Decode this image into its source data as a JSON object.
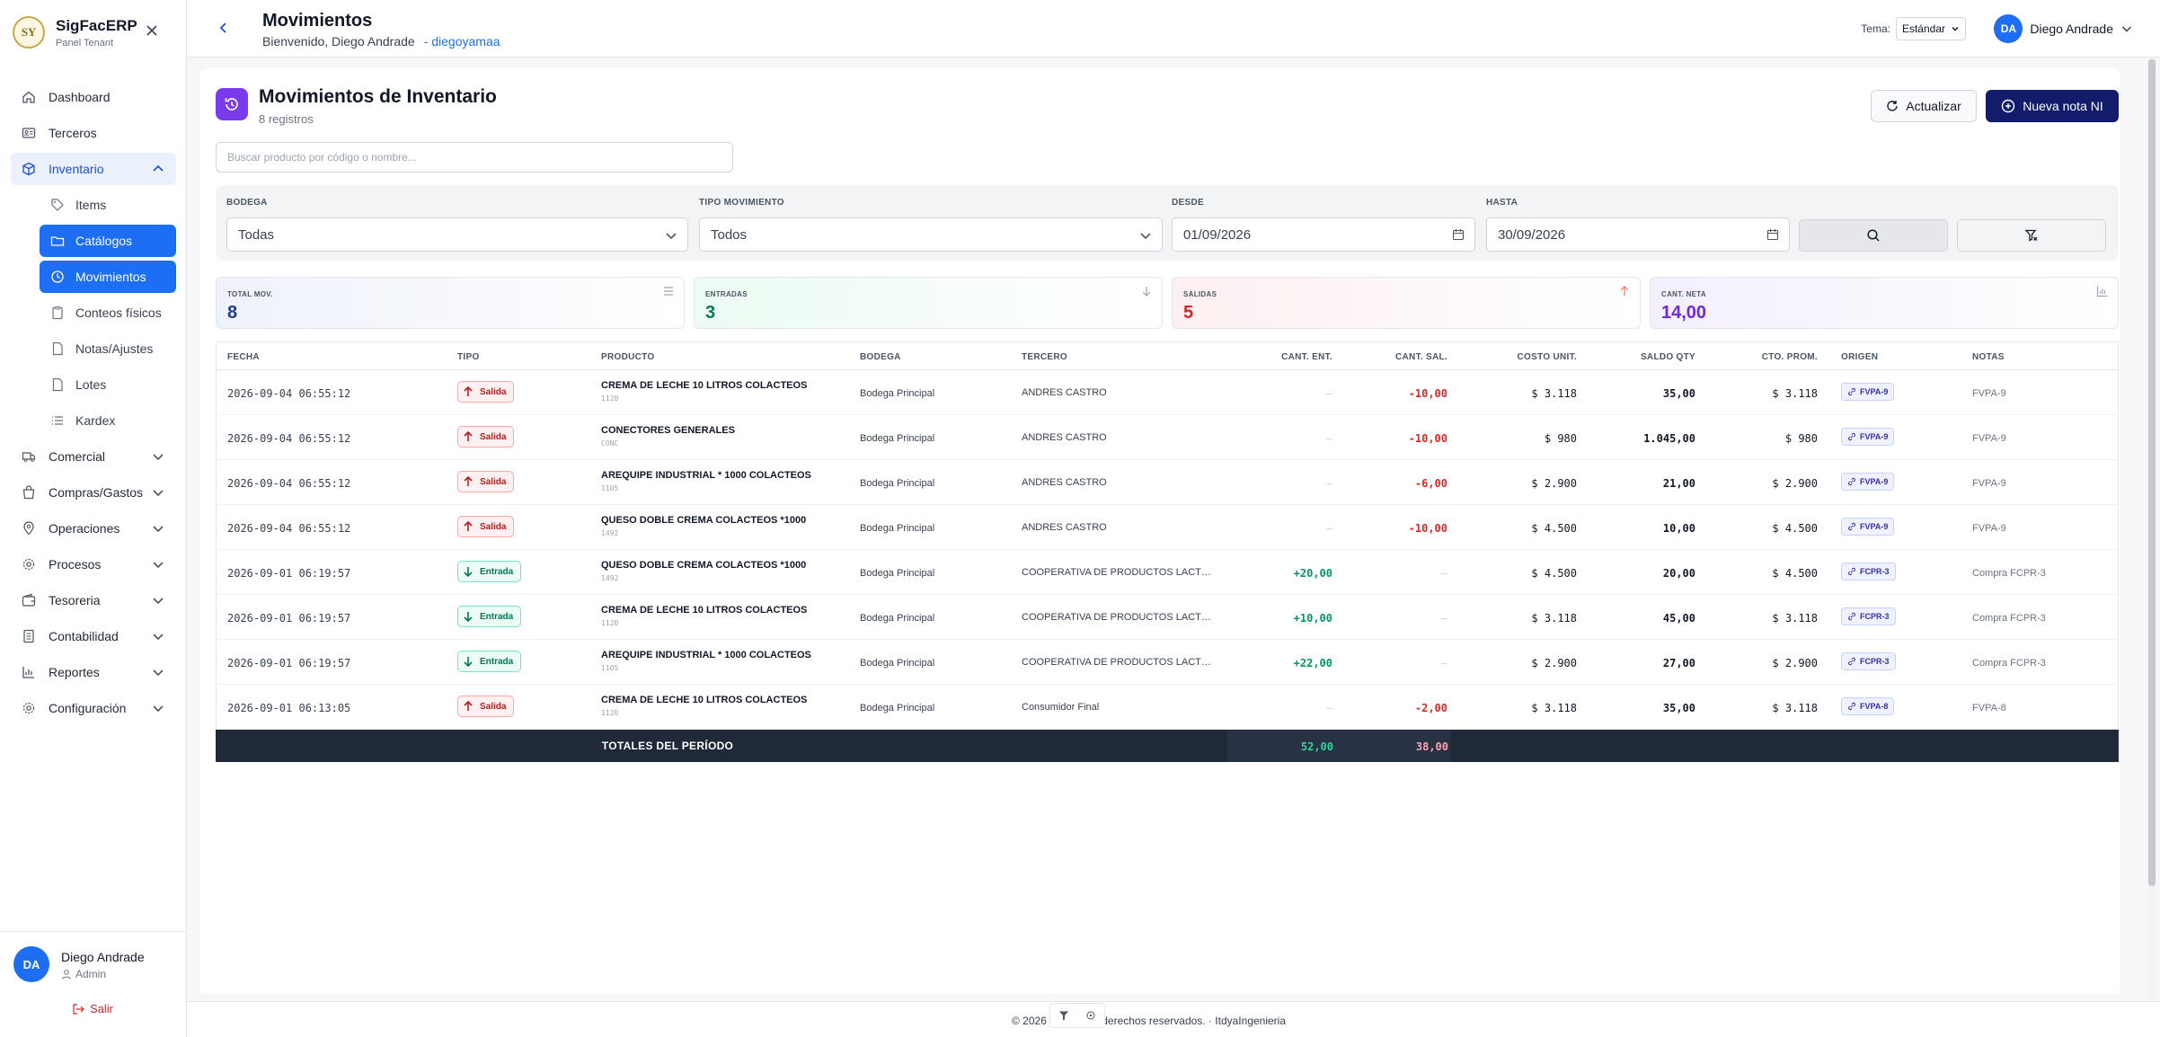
{
  "brand": {
    "name": "SigFacERP",
    "sub": "Panel Tenant",
    "logo_text": "SY"
  },
  "nav": {
    "dashboard": "Dashboard",
    "terceros": "Terceros",
    "inventario": "Inventario",
    "inventario_sub": [
      "Items",
      "Catálogos",
      "Movimientos",
      "Conteos físicos",
      "Notas/Ajustes",
      "Lotes",
      "Kardex"
    ],
    "groups": [
      "Comercial",
      "Compras/Gastos",
      "Operaciones",
      "Procesos",
      "Tesoreria",
      "Contabilidad",
      "Reportes",
      "Configuración"
    ]
  },
  "side_user": {
    "initials": "DA",
    "name": "Diego Andrade",
    "role": "Admin",
    "logout": "Salir"
  },
  "header": {
    "title": "Movimientos",
    "welcome": "Bienvenido, Diego Andrade",
    "username": "- diegoyamaa",
    "theme_label": "Tema:",
    "theme_value": "Estándar",
    "user_initials": "DA",
    "user_name": "Diego Andrade"
  },
  "page": {
    "title": "Movimientos de Inventario",
    "count": "8 registros",
    "refresh_label": "Actualizar",
    "new_label": "Nueva nota NI",
    "search_placeholder": "Buscar producto por código o nombre..."
  },
  "filters": {
    "bodega_label": "BODEGA",
    "bodega_value": "Todas",
    "tipo_label": "TIPO MOVIMIENTO",
    "tipo_value": "Todos",
    "desde_label": "DESDE",
    "desde_value": "01/09/2026",
    "hasta_label": "HASTA",
    "hasta_value": "30/09/2026"
  },
  "stats": [
    {
      "label": "TOTAL MOV.",
      "value": "8",
      "color": "#1e3a8a"
    },
    {
      "label": "ENTRADAS",
      "value": "3",
      "color": "#047857"
    },
    {
      "label": "SALIDAS",
      "value": "5",
      "color": "#dc2626"
    },
    {
      "label": "CANT. NETA",
      "value": "14,00",
      "color": "#6d28d9"
    }
  ],
  "table": {
    "headers": [
      "FECHA",
      "TIPO",
      "PRODUCTO",
      "BODEGA",
      "TERCERO",
      "CANT. ENT.",
      "CANT. SAL.",
      "COSTO UNIT.",
      "SALDO QTY",
      "CTO. PROM.",
      "ORIGEN",
      "NOTAS"
    ],
    "rows": [
      {
        "fecha": "2026-09-04 06:55:12",
        "tipo": "Salida",
        "producto": "CREMA DE LECHE 10 LITROS COLACTEOS",
        "codigo": "1120",
        "bodega": "Bodega Principal",
        "tercero": "ANDRES CASTRO",
        "ent": "—",
        "sal": "-10,00",
        "costo": "$ 3.118",
        "saldo": "35,00",
        "prom": "$ 3.118",
        "origen": "FVPA-9",
        "notas": "FVPA-9"
      },
      {
        "fecha": "2026-09-04 06:55:12",
        "tipo": "Salida",
        "producto": "CONECTORES GENERALES",
        "codigo": "CONC",
        "bodega": "Bodega Principal",
        "tercero": "ANDRES CASTRO",
        "ent": "—",
        "sal": "-10,00",
        "costo": "$ 980",
        "saldo": "1.045,00",
        "prom": "$ 980",
        "origen": "FVPA-9",
        "notas": "FVPA-9"
      },
      {
        "fecha": "2026-09-04 06:55:12",
        "tipo": "Salida",
        "producto": "AREQUIPE INDUSTRIAL * 1000 COLACTEOS",
        "codigo": "1105",
        "bodega": "Bodega Principal",
        "tercero": "ANDRES CASTRO",
        "ent": "—",
        "sal": "-6,00",
        "costo": "$ 2.900",
        "saldo": "21,00",
        "prom": "$ 2.900",
        "origen": "FVPA-9",
        "notas": "FVPA-9"
      },
      {
        "fecha": "2026-09-04 06:55:12",
        "tipo": "Salida",
        "producto": "QUESO DOBLE CREMA COLACTEOS *1000",
        "codigo": "1492",
        "bodega": "Bodega Principal",
        "tercero": "ANDRES CASTRO",
        "ent": "—",
        "sal": "-10,00",
        "costo": "$ 4.500",
        "saldo": "10,00",
        "prom": "$ 4.500",
        "origen": "FVPA-9",
        "notas": "FVPA-9"
      },
      {
        "fecha": "2026-09-01 06:19:57",
        "tipo": "Entrada",
        "producto": "QUESO DOBLE CREMA COLACTEOS *1000",
        "codigo": "1492",
        "bodega": "Bodega Principal",
        "tercero": "COOPERATIVA DE PRODUCTOS LACTEOS ...",
        "ent": "+20,00",
        "sal": "—",
        "costo": "$ 4.500",
        "saldo": "20,00",
        "prom": "$ 4.500",
        "origen": "FCPR-3",
        "notas": "Compra FCPR-3"
      },
      {
        "fecha": "2026-09-01 06:19:57",
        "tipo": "Entrada",
        "producto": "CREMA DE LECHE 10 LITROS COLACTEOS",
        "codigo": "1120",
        "bodega": "Bodega Principal",
        "tercero": "COOPERATIVA DE PRODUCTOS LACTEOS ...",
        "ent": "+10,00",
        "sal": "—",
        "costo": "$ 3.118",
        "saldo": "45,00",
        "prom": "$ 3.118",
        "origen": "FCPR-3",
        "notas": "Compra FCPR-3"
      },
      {
        "fecha": "2026-09-01 06:19:57",
        "tipo": "Entrada",
        "producto": "AREQUIPE INDUSTRIAL * 1000 COLACTEOS",
        "codigo": "1105",
        "bodega": "Bodega Principal",
        "tercero": "COOPERATIVA DE PRODUCTOS LACTEOS ...",
        "ent": "+22,00",
        "sal": "—",
        "costo": "$ 2.900",
        "saldo": "27,00",
        "prom": "$ 2.900",
        "origen": "FCPR-3",
        "notas": "Compra FCPR-3"
      },
      {
        "fecha": "2026-09-01 06:13:05",
        "tipo": "Salida",
        "producto": "CREMA DE LECHE 10 LITROS COLACTEOS",
        "codigo": "1120",
        "bodega": "Bodega Principal",
        "tercero": "Consumidor Final",
        "ent": "—",
        "sal": "-2,00",
        "costo": "$ 3.118",
        "saldo": "35,00",
        "prom": "$ 3.118",
        "origen": "FVPA-8",
        "notas": "FVPA-8"
      }
    ],
    "totals_label": "TOTALES DEL PERÍODO",
    "totals_ent": "52,00",
    "totals_sal": "38,00"
  },
  "footer": {
    "text": "© 2026 ...odos los derechos reservados. · ItdyaIngenieria"
  },
  "colors": {
    "primary": "#1d6ef2",
    "new_button": "#111d6b",
    "header_icon": "#7c3aed",
    "totals_bar": "#1f2937"
  },
  "icons": [
    "close-icon",
    "home-icon",
    "id-card-icon",
    "box-icon",
    "tag-icon",
    "folder-icon",
    "history-icon",
    "clipboard-icon",
    "file-icon",
    "list-icon",
    "chevron-down-icon",
    "chevron-up-icon",
    "search-icon",
    "filter-x-icon",
    "calendar-icon",
    "refresh-icon",
    "plus-circle-icon",
    "arrow-up-icon",
    "arrow-down-icon",
    "link-icon",
    "logout-icon",
    "user-icon"
  ]
}
